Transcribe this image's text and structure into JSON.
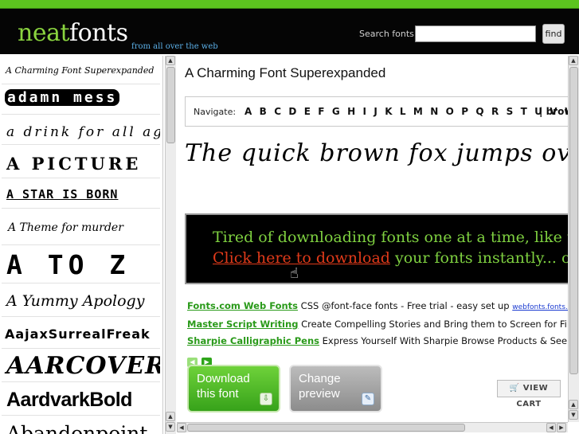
{
  "header": {
    "logo_part1": "neat",
    "logo_part2": "fonts",
    "tagline": "from all over the web",
    "search_label": "Search fonts:",
    "search_value": "",
    "find_label": "find"
  },
  "font_list": [
    {
      "name": "A Charming Font Superexpanded"
    },
    {
      "name": "adamn mess"
    },
    {
      "name": "a drink for all ages"
    },
    {
      "name": "A PICTURE"
    },
    {
      "name": "A STAR IS BORN"
    },
    {
      "name": "A Theme for murder"
    },
    {
      "name": "A TO Z"
    },
    {
      "name": "A Yummy Apology"
    },
    {
      "name": "AajaxSurrealFreak"
    },
    {
      "name": "AARCOVER"
    },
    {
      "name": "AardvarkBold"
    },
    {
      "name": "Abandonpoint"
    }
  ],
  "main": {
    "font_title": "A Charming Font Superexpanded",
    "nav_label": "Navigate:",
    "letters": "A B C D E F G H I J K L M N O P Q R S T U V W X Y Z",
    "separator": "|",
    "browse_label": "brows",
    "preview_text": "The quick brown fox jumps over the",
    "banner_line1": "Tired of downloading fonts one at a time, like thi",
    "banner_link": "Click here to download",
    "banner_line2_rest": " your fonts instantly... onl"
  },
  "ads": [
    {
      "title": "Fonts.com Web Fonts",
      "text": " CSS @font-face fonts - Free trial - easy set up ",
      "url": "webfonts.fonts.com"
    },
    {
      "title": "Master Script Writing",
      "text": " Create Compelling Stories and Bring them to Screen for Film and G",
      "url": ""
    },
    {
      "title": "Sharpie Calligraphic Pens",
      "text": " Express Yourself With Sharpie Browse Products & See Where",
      "url": ""
    }
  ],
  "actions": {
    "download_label_1": "Download",
    "download_label_2": "this font",
    "change_label_1": "Change",
    "change_label_2": "preview",
    "cart_label": "VIEW CART"
  },
  "colors": {
    "brand_green": "#8ad43f",
    "header_bg": "#050505",
    "ad_title": "#2a9a1a",
    "banner_link": "#e03a1a"
  }
}
